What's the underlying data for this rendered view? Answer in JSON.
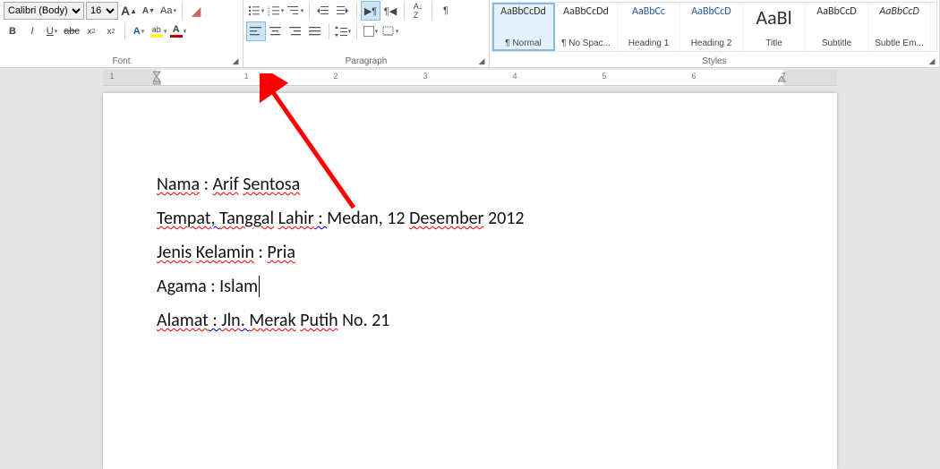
{
  "font": {
    "name": "Calibri (Body)",
    "size": "16",
    "group_label": "Font",
    "bold": "B",
    "italic": "I",
    "underline": "U",
    "strike": "abc",
    "sub": "x",
    "sup": "x",
    "case": "Aa",
    "clearfmt": "A"
  },
  "paragraph": {
    "group_label": "Paragraph"
  },
  "styles_label": "Styles",
  "styles": [
    {
      "sample": "AaBbCcDd",
      "name": "¶ Normal",
      "blue": false,
      "big": false
    },
    {
      "sample": "AaBbCcDd",
      "name": "¶ No Spac...",
      "blue": false,
      "big": false
    },
    {
      "sample": "AaBbCc",
      "name": "Heading 1",
      "blue": true,
      "big": false
    },
    {
      "sample": "AaBbCcD",
      "name": "Heading 2",
      "blue": true,
      "big": false
    },
    {
      "sample": "AaBl",
      "name": "Title",
      "blue": false,
      "big": true
    },
    {
      "sample": "AaBbCcD",
      "name": "Subtitle",
      "blue": false,
      "big": false
    },
    {
      "sample": "AaBbCcD",
      "name": "Subtle Em...",
      "blue": false,
      "big": false,
      "italic": true
    }
  ],
  "ruler": {
    "nums": [
      "1",
      "1",
      "2",
      "3",
      "4",
      "5",
      "6",
      "7"
    ]
  },
  "doc": {
    "l1_a": "Nama",
    "l1_b": " : ",
    "l1_c": "Arif",
    "l1_d": " ",
    "l1_e": "Sentosa",
    "l2_a": "Tempat",
    "l2_b": ", ",
    "l2_c": "Tanggal",
    "l2_d": " ",
    "l2_e": "Lahir",
    "l2_f": " : ",
    "l2_g": "Medan, 12 ",
    "l2_h": "Desember",
    "l2_i": " 2012",
    "l3_a": "Jenis",
    "l3_b": " ",
    "l3_c": "Kelamin",
    "l3_d": " : ",
    "l3_e": "Pria",
    "l4_a": "Agama : Islam",
    "l5_a": "Alamat",
    "l5_b": " : ",
    "l5_c": "Jln",
    "l5_d": ". ",
    "l5_e": "Merak",
    "l5_f": " ",
    "l5_g": "Putih",
    "l5_h": " No. 21"
  }
}
